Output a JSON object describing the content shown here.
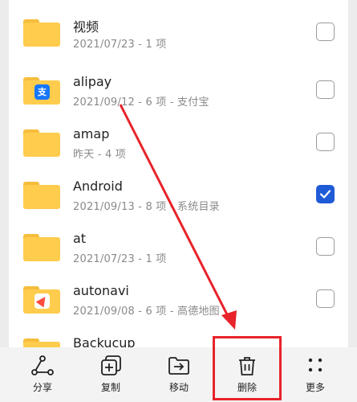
{
  "files": [
    {
      "name": "视频",
      "meta": "2021/07/23 - 1 项",
      "badge": "",
      "checked": false
    },
    {
      "name": "alipay",
      "meta": "2021/09/12 - 6 项 - 支付宝",
      "badge": "支",
      "checked": false
    },
    {
      "name": "amap",
      "meta": "昨天 - 4 项",
      "badge": "",
      "checked": false
    },
    {
      "name": "Android",
      "meta": "2021/09/13 - 8 项 - 系统目录",
      "badge": "",
      "checked": true
    },
    {
      "name": "at",
      "meta": "2021/07/23 - 1 项",
      "badge": "",
      "checked": false
    },
    {
      "name": "autonavi",
      "meta": "2021/09/08 - 6 项 - 高德地图",
      "badge": "",
      "checked": false
    },
    {
      "name": "Backucup",
      "meta": "",
      "badge": "",
      "checked": false
    }
  ],
  "toolbar": {
    "share": "分享",
    "copy": "复制",
    "move": "移动",
    "delete": "删除",
    "more": "更多"
  },
  "colors": {
    "folder": "#ffcc4d",
    "check_accent": "#1f5bd6",
    "annotation": "#e8232a"
  },
  "icons": [
    "share-icon",
    "copy-icon",
    "move-icon",
    "trash-icon",
    "more-icon"
  ]
}
